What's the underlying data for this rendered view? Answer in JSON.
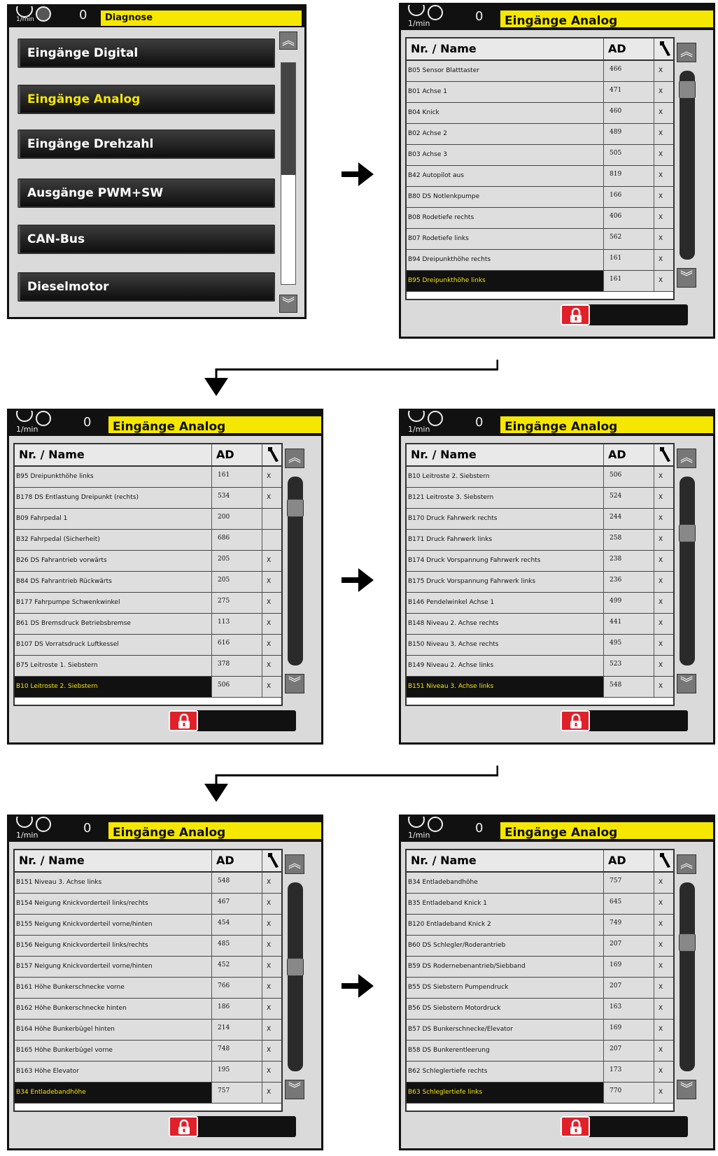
{
  "menu_screen": {
    "rpm_unit": "1/min",
    "rpm_value": "0",
    "title": "Diagnose",
    "items": [
      "Eingänge Digital",
      "Eingänge Analog",
      "Eingänge Drehzahl",
      "Ausgänge PWM+SW",
      "CAN-Bus",
      "Dieselmotor"
    ]
  },
  "columns": {
    "name": "Nr. / Name",
    "ad": "AD"
  },
  "common": {
    "rpm_unit": "1/min",
    "rpm_value": "0",
    "title": "Eingänge Analog"
  },
  "screens": [
    {
      "rows": [
        [
          "B05 Sensor Blatttaster",
          "466",
          "X"
        ],
        [
          "B01 Achse 1",
          "471",
          "X"
        ],
        [
          "B04 Knick",
          "460",
          "X"
        ],
        [
          "B02 Achse 2",
          "489",
          "X"
        ],
        [
          "B03 Achse 3",
          "505",
          "X"
        ],
        [
          "B42 Autopilot aus",
          "819",
          "X"
        ],
        [
          "B80 DS Notlenkpumpe",
          "166",
          "X"
        ],
        [
          "B08 Rodetiefe rechts",
          "406",
          "X"
        ],
        [
          "B07 Rodetiefe links",
          "562",
          "X"
        ],
        [
          "B94 Dreipunkthöhe rechts",
          "161",
          "X"
        ],
        [
          "B95 Dreipunkthöhe links",
          "161",
          "X"
        ]
      ],
      "scroll_position": 0.05
    },
    {
      "rows": [
        [
          "B95 Dreipunkthöhe links",
          "161",
          "X"
        ],
        [
          "B178 DS Entlastung Dreipunkt (rechts)",
          "534",
          "X"
        ],
        [
          "B09 Fahrpedal 1",
          "200",
          ""
        ],
        [
          "B32 Fahrpedal (Sicherheit)",
          "686",
          ""
        ],
        [
          "B26 DS Fahrantrieb vorwärts",
          "205",
          "X"
        ],
        [
          "B84 DS Fahrantrieb Rückwärts",
          "205",
          "X"
        ],
        [
          "B177 Fahrpumpe Schwenkwinkel",
          "275",
          "X"
        ],
        [
          "B61 DS Bremsdruck Betriebsbremse",
          "113",
          "X"
        ],
        [
          "B107 DS Vorratsdruck Luftkessel",
          "616",
          "X"
        ],
        [
          "B75 Leitroste 1. Siebstern",
          "378",
          "X"
        ],
        [
          "B10 Leitroste 2. Siebstern",
          "506",
          "X"
        ]
      ],
      "scroll_position": 0.12
    },
    {
      "rows": [
        [
          "B10 Leitroste 2. Siebstern",
          "506",
          "X"
        ],
        [
          "B121 Leitroste 3. Siebstern",
          "524",
          "X"
        ],
        [
          "B170 Druck Fahrwerk rechts",
          "244",
          "X"
        ],
        [
          "B171 Druck Fahrwerk links",
          "258",
          "X"
        ],
        [
          "B174 Druck Vorspannung Fahrwerk rechts",
          "238",
          "X"
        ],
        [
          "B175 Druck Vorspannung Fahrwerk links",
          "236",
          "X"
        ],
        [
          "B146 Pendelwinkel Achse 1",
          "499",
          "X"
        ],
        [
          "B148 Niveau 2. Achse rechts",
          "441",
          "X"
        ],
        [
          "B150 Niveau 3. Achse rechts",
          "495",
          "X"
        ],
        [
          "B149 Niveau 2. Achse links",
          "523",
          "X"
        ],
        [
          "B151 Niveau 3. Achse links",
          "548",
          "X"
        ]
      ],
      "scroll_position": 0.25
    },
    {
      "rows": [
        [
          "B151 Niveau 3. Achse links",
          "548",
          "X"
        ],
        [
          "B154 Neigung Knickvorderteil links/rechts",
          "467",
          "X"
        ],
        [
          "B155 Neigung Knickvorderteil vorne/hinten",
          "454",
          "X"
        ],
        [
          "B156 Neigung Knickvorderteil links/rechts",
          "485",
          "X"
        ],
        [
          "B157 Neigung Knickvorderteil vorne/hinten",
          "452",
          "X"
        ],
        [
          "B161 Höhe Bunkerschnecke vorne",
          "766",
          "X"
        ],
        [
          "B162 Höhe Bunkerschnecke hinten",
          "186",
          "X"
        ],
        [
          "B164 Höhe Bunkerbügel hinten",
          "214",
          "X"
        ],
        [
          "B165 Höhe Bunkerbügel vorne",
          "748",
          "X"
        ],
        [
          "B163 Höhe Elevator",
          "195",
          "X"
        ],
        [
          "B34 Entladebandhöhe",
          "757",
          "X"
        ]
      ],
      "scroll_position": 0.4
    },
    {
      "rows": [
        [
          "B34 Entladebandhöhe",
          "757",
          "X"
        ],
        [
          "B35 Entladeband Knick 1",
          "645",
          "X"
        ],
        [
          "B120 Entladeband Knick 2",
          "749",
          "X"
        ],
        [
          "B60 DS Schlegler/Roderantrieb",
          "207",
          "X"
        ],
        [
          "B59 DS Rodernebenantrieb/Siebband",
          "169",
          "X"
        ],
        [
          "B55 DS Siebstern Pumpendruck",
          "207",
          "X"
        ],
        [
          "B56 DS Siebstern Motordruck",
          "163",
          "X"
        ],
        [
          "B57 DS Bunkerschnecke/Elevator",
          "169",
          "X"
        ],
        [
          "B58 DS Bunkerentleerung",
          "207",
          "X"
        ],
        [
          "B62 Schleglertiefe rechts",
          "173",
          "X"
        ],
        [
          "B63 Schleglertiefe links",
          "770",
          "X"
        ]
      ],
      "scroll_position": 0.27
    }
  ]
}
